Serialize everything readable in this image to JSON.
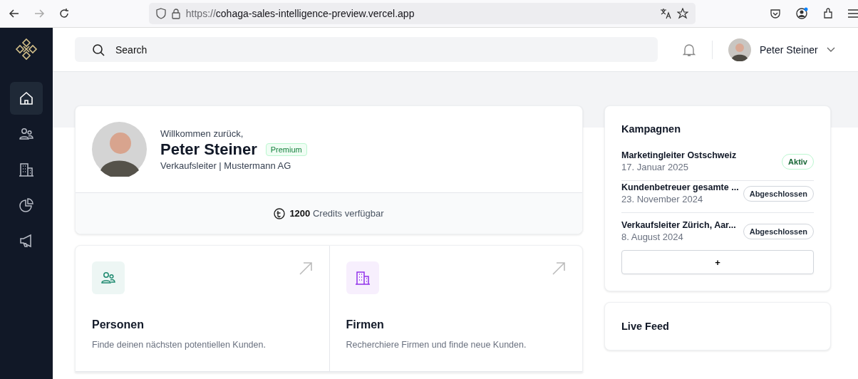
{
  "browser": {
    "url_prefix": "https://",
    "url_host": "cohaga-sales-intelligence-preview.vercel.app"
  },
  "sidebar": {
    "items": [
      {
        "selected": true
      },
      {
        "selected": false
      },
      {
        "selected": false
      },
      {
        "selected": false
      },
      {
        "selected": false
      }
    ]
  },
  "header": {
    "search": {
      "placeholder": "Search"
    },
    "user": {
      "name": "Peter Steiner"
    }
  },
  "profile": {
    "greeting": "Willkommen zurück,",
    "name": "Peter Steiner",
    "badge": "Premium",
    "role": "Verkaufsleiter | Mustermann AG",
    "credits_amount": "1200",
    "credits_text": "Credits verfügbar"
  },
  "tiles": [
    {
      "color": "#1f8a70",
      "title": "Personen",
      "description": "Finde deinen nächsten potentiellen Kunden."
    },
    {
      "color": "#9333ea",
      "title": "Firmen",
      "description": "Recherchiere Firmen und finde neue Kunden."
    }
  ],
  "campaigns": {
    "title": "Kampagnen",
    "items": [
      {
        "name": "Marketingleiter Ostschweiz",
        "date": "17. Januar 2025",
        "status": "Aktiv",
        "kind": "active"
      },
      {
        "name": "Kundenbetreuer gesamte ...",
        "date": "23. November 2024",
        "status": "Abgeschlossen",
        "kind": "done"
      },
      {
        "name": "Verkaufsleiter Zürich, Aar...",
        "date": "8. August 2024",
        "status": "Abgeschlossen",
        "kind": "done"
      }
    ],
    "add_label": "+"
  },
  "live_feed": {
    "title": "Live Feed"
  }
}
